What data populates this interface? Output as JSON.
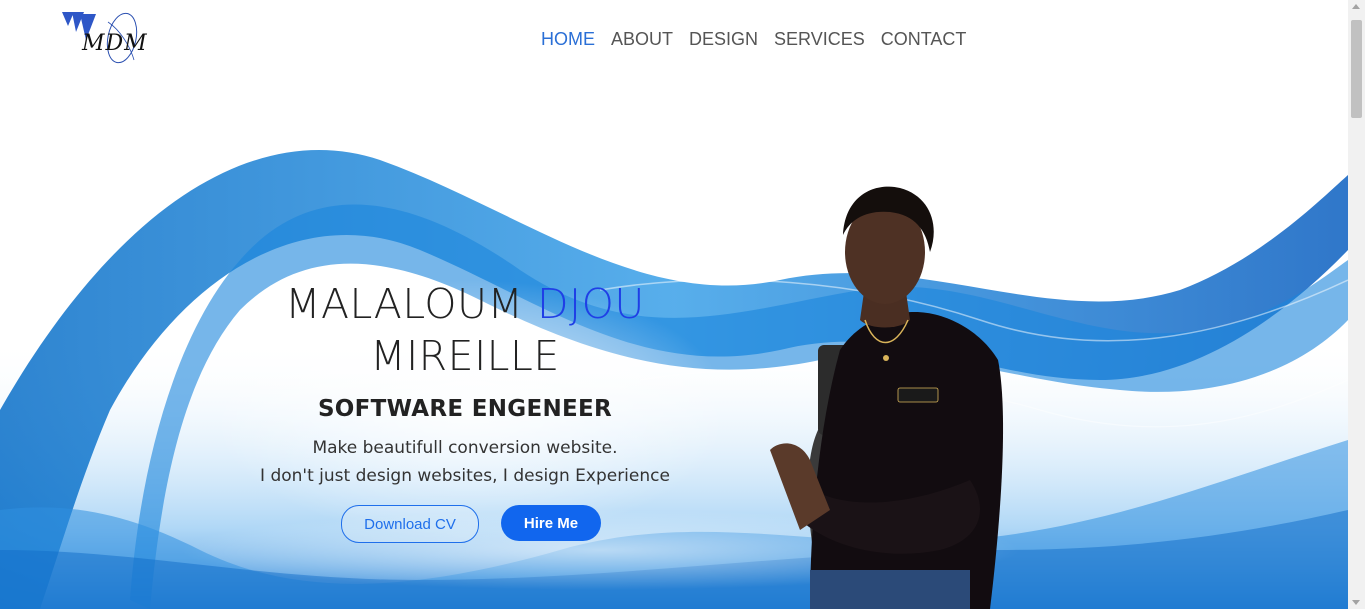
{
  "logo": {
    "text": "MDM"
  },
  "nav": {
    "items": [
      {
        "label": "HOME",
        "active": true
      },
      {
        "label": "ABOUT",
        "active": false
      },
      {
        "label": "DESIGN",
        "active": false
      },
      {
        "label": "SERVICES",
        "active": false
      },
      {
        "label": "CONTACT",
        "active": false
      }
    ]
  },
  "hero": {
    "name_first": "MALALOUM",
    "name_highlight": "DJOU",
    "name_last": "MIREILLE",
    "role": "SOFTWARE ENGENEER",
    "tagline_1": "Make beautifull conversion website.",
    "tagline_2": "I don't just design websites, I design Experience",
    "download_button": "Download CV",
    "hire_button": "Hire Me"
  },
  "colors": {
    "accent": "#1f3fe6",
    "nav_active": "#2a6fd6",
    "button": "#1166ee",
    "wave": "#0b79d0"
  }
}
